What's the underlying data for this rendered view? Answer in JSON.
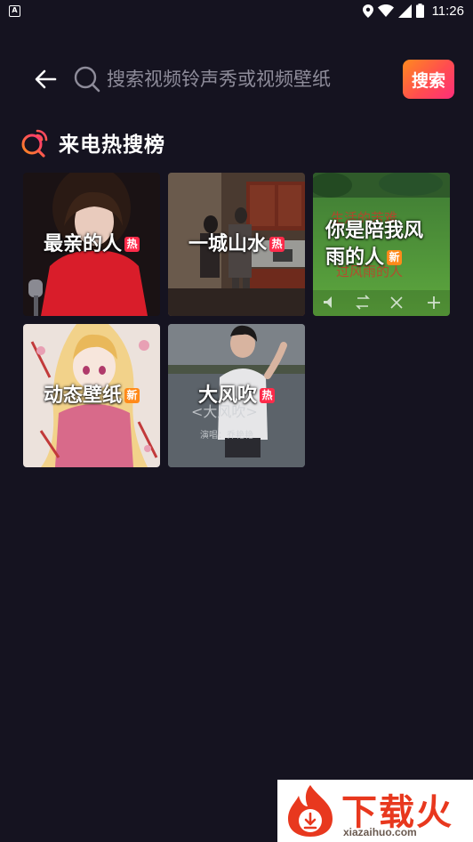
{
  "status_bar": {
    "time": "11:26",
    "notification_icon": "app-notification-icon",
    "icons": [
      "location-icon",
      "wifi-icon",
      "cellular-signal-icon",
      "battery-icon"
    ]
  },
  "header": {
    "back_icon": "arrow-left-icon",
    "search_icon": "search-icon",
    "search_placeholder": "搜索视频铃声秀或视频壁纸",
    "search_button_label": "搜索"
  },
  "section": {
    "title": "来电热搜榜",
    "icon": "hot-search-icon"
  },
  "tiles": [
    {
      "title": "最亲的人",
      "badge": "热",
      "badge_type": "hot",
      "thumb": "girl-red-sweater"
    },
    {
      "title": "一城山水",
      "badge": "热",
      "badge_type": "hot",
      "thumb": "kitchen-dance"
    },
    {
      "title": "你是陪我风雨的人",
      "badge": "新",
      "badge_type": "new",
      "thumb": "green-field"
    },
    {
      "title": "动态壁纸",
      "badge": "新",
      "badge_type": "new",
      "thumb": "anime-girl"
    },
    {
      "title": "大风吹",
      "badge": "热",
      "badge_type": "hot",
      "thumb": "lakeside-girl"
    }
  ],
  "watermark": {
    "brand": "下载火",
    "url": "xiazaihuo.com",
    "accent": "#e8381e"
  },
  "colors": {
    "background": "#151320",
    "search_button_gradient": [
      "#ff8a1f",
      "#ff2d7a"
    ],
    "hot_badge": "#ff2b4a",
    "new_badge": "#ff8a1a"
  }
}
